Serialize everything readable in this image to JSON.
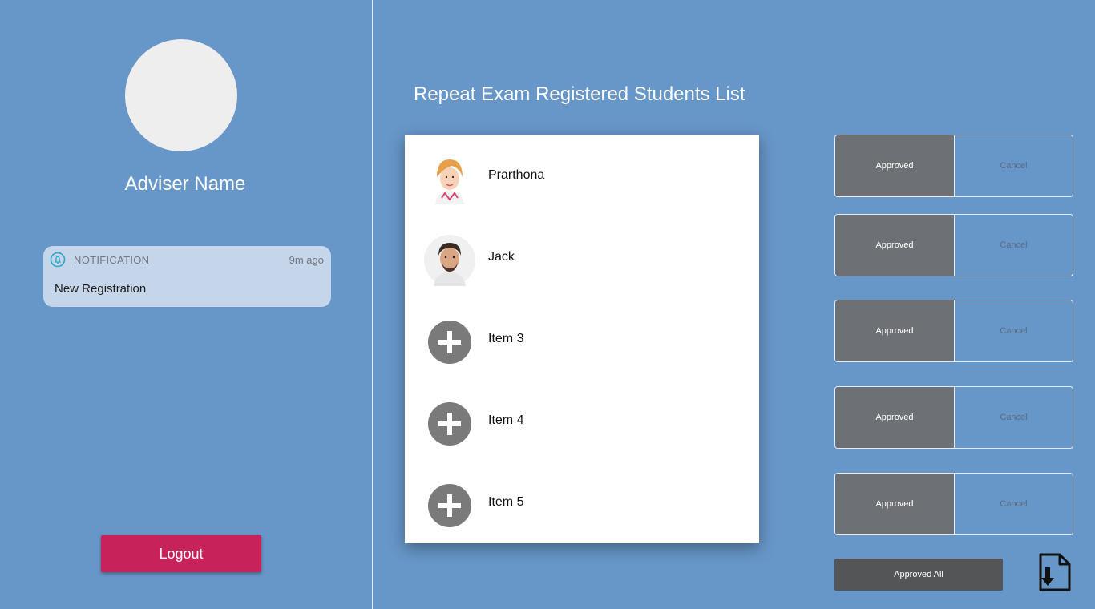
{
  "sidebar": {
    "adviser_name": "Adviser Name",
    "notification": {
      "app": "NOTIFICATION",
      "time": "9m ago",
      "message": "New Registration"
    },
    "logout_label": "Logout"
  },
  "main": {
    "title": "Repeat Exam Registered Students List",
    "students": [
      {
        "name": "Prarthona",
        "avatar": "female-student-photo"
      },
      {
        "name": "Jack",
        "avatar": "male-student-photo"
      },
      {
        "name": "Item 3",
        "avatar": "plus-circle-icon"
      },
      {
        "name": "Item 4",
        "avatar": "plus-circle-icon"
      },
      {
        "name": "Item 5",
        "avatar": "plus-circle-icon"
      }
    ],
    "actions": [
      {
        "approve": "Approved",
        "cancel": "Cancel"
      },
      {
        "approve": "Approved",
        "cancel": "Cancel"
      },
      {
        "approve": "Approved",
        "cancel": "Cancel"
      },
      {
        "approve": "Approved",
        "cancel": "Cancel"
      },
      {
        "approve": "Approved",
        "cancel": "Cancel"
      }
    ],
    "approve_all_label": "Approved All",
    "download_icon": "file-download-icon"
  },
  "colors": {
    "background": "#6796c8",
    "logout": "#c7235a",
    "approve": "#6d7074",
    "approve_all": "#545557"
  }
}
